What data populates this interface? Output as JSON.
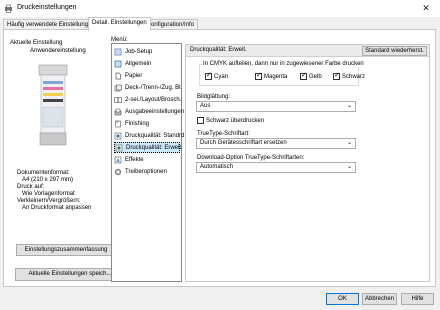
{
  "window": {
    "title": "Druckeinstellungen",
    "close_glyph": "✕"
  },
  "tabs": [
    {
      "label": "Häufig verwendete Einstellungen"
    },
    {
      "label": "Detail. Einstellungen"
    },
    {
      "label": "Konfiguration/Info"
    }
  ],
  "left": {
    "current_label": "Aktuelle Einstellung",
    "current_value": "Anwendereinstellung",
    "doc_format_label": "Dokumentenformat:",
    "doc_format_value": "A4 (210 x 297 mm)",
    "print_on_label": "Druck auf:",
    "print_on_value": "Wie Vorlagenformat",
    "scale_label": "Verkleinern/Vergrößern:",
    "scale_value": "An Druckformat anpassen",
    "summary_button": "Einstellungszusammenfassung",
    "current_settings_button": "Aktuelle Einstellungen speich..."
  },
  "menu": {
    "label": "Menü:",
    "items": [
      {
        "label": "Job-Setup",
        "icon": "job-setup-icon"
      },
      {
        "label": "Allgemein",
        "icon": "general-icon"
      },
      {
        "label": "Papier",
        "icon": "paper-icon"
      },
      {
        "label": "Deck-/Trenn-/Zug. Bl.",
        "icon": "cover-sheet-icon"
      },
      {
        "label": "2-sei./Layout/Brosch.",
        "icon": "layout-icon"
      },
      {
        "label": "Ausgabeeinstellungen",
        "icon": "output-icon"
      },
      {
        "label": "Finishing",
        "icon": "finishing-icon"
      },
      {
        "label": "Druckqualität: Standrd.",
        "icon": "print-quality-icon"
      },
      {
        "label": "Druckqualität: Erweit.",
        "icon": "print-quality-advanced-icon"
      },
      {
        "label": "Effekte",
        "icon": "effects-icon"
      },
      {
        "label": "Treiberoptionen",
        "icon": "driver-options-icon"
      }
    ]
  },
  "right": {
    "header": "Druckqualität: Erweit.",
    "restore_button": "Standard wiederherst.",
    "cmyk_group_label": "In CMYK aufteilen, dann nur in zugewiesener Farbe drucken",
    "cmyk": [
      {
        "label": "Cyan",
        "checked": true
      },
      {
        "label": "Magenta",
        "checked": true
      },
      {
        "label": "Gelb",
        "checked": true
      },
      {
        "label": "Schwarz",
        "checked": true
      }
    ],
    "smoothing_label": "Bildglättung:",
    "smoothing_value": "Aus",
    "black_overprint_label": "Schwarz überdrucken",
    "black_overprint_checked": false,
    "truetype_label": "TrueType-Schriftart:",
    "truetype_value": "Durch Gerätesschriftart ersetzen",
    "download_label": "Download-Option TrueType-Schriftarten:",
    "download_value": "Automatisch"
  },
  "footer": {
    "ok": "OK",
    "cancel": "Abbrechen",
    "help": "Hilfe"
  },
  "colors": {
    "accent": "#0078d7",
    "selection": "#cce8ff"
  }
}
